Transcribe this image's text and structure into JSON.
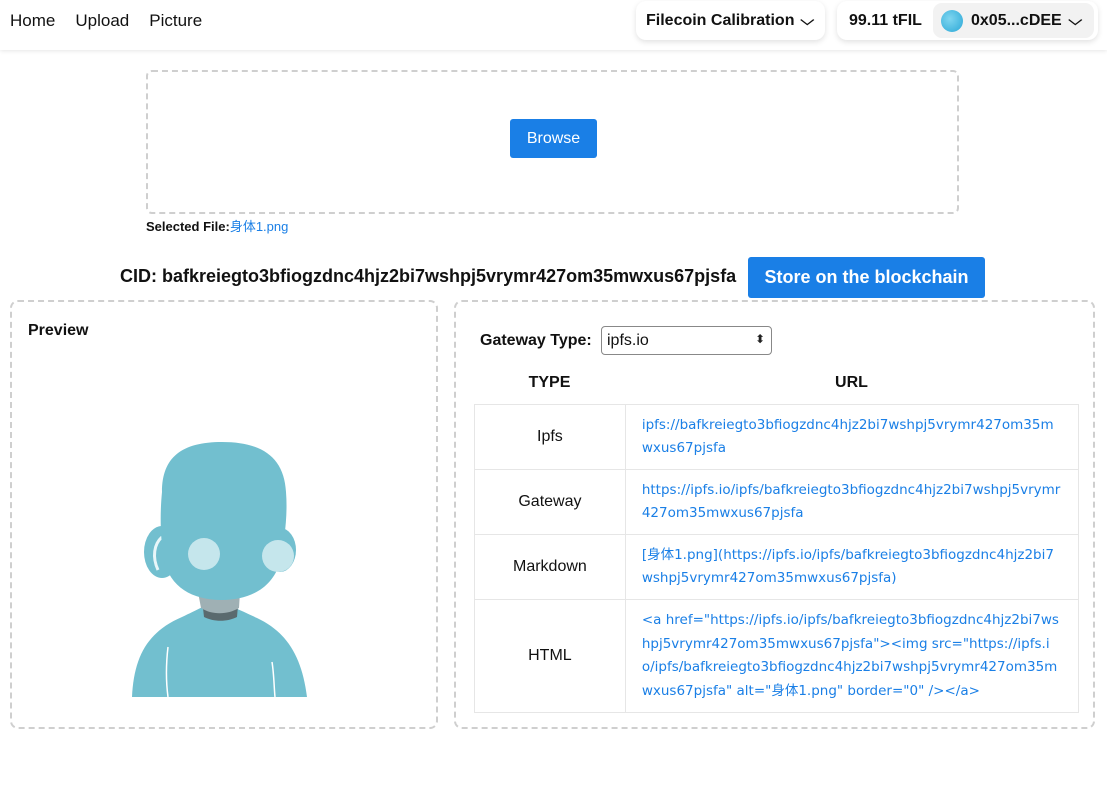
{
  "nav": {
    "links": [
      "Home",
      "Upload",
      "Picture"
    ],
    "network": "Filecoin Calibration",
    "balance": "99.11 tFIL",
    "account": "0x05...cDEE"
  },
  "upload": {
    "browse_label": "Browse",
    "selected_label": "Selected File:",
    "selected_file": "身体1.png"
  },
  "cid": {
    "text": "CID: bafkreiegto3bfiogzdnc4hjz2bi7wshpj5vrymr427om35mwxus67pjsfa",
    "store_label": "Store on the blockchain"
  },
  "preview": {
    "title": "Preview"
  },
  "gateway": {
    "label": "Gateway Type:",
    "selected": "ipfs.io",
    "columns": [
      "TYPE",
      "URL"
    ],
    "rows": [
      {
        "type": "Ipfs",
        "url": "ipfs://bafkreiegto3bfiogzdnc4hjz2bi7wshpj5vrymr427om35mwxus67pjsfa"
      },
      {
        "type": "Gateway",
        "url": "https://ipfs.io/ipfs/bafkreiegto3bfiogzdnc4hjz2bi7wshpj5vrymr427om35mwxus67pjsfa"
      },
      {
        "type": "Markdown",
        "url": "[身体1.png](https://ipfs.io/ipfs/bafkreiegto3bfiogzdnc4hjz2bi7wshpj5vrymr427om35mwxus67pjsfa)"
      },
      {
        "type": "HTML",
        "url": "<a href=\"https://ipfs.io/ipfs/bafkreiegto3bfiogzdnc4hjz2bi7wshpj5vrymr427om35mwxus67pjsfa\"><img src=\"https://ipfs.io/ipfs/bafkreiegto3bfiogzdnc4hjz2bi7wshpj5vrymr427om35mwxus67pjsfa\" alt=\"身体1.png\" border=\"0\" /></a>"
      }
    ]
  },
  "colors": {
    "accent": "#1a7fe6",
    "figure": "#72bfcf"
  }
}
